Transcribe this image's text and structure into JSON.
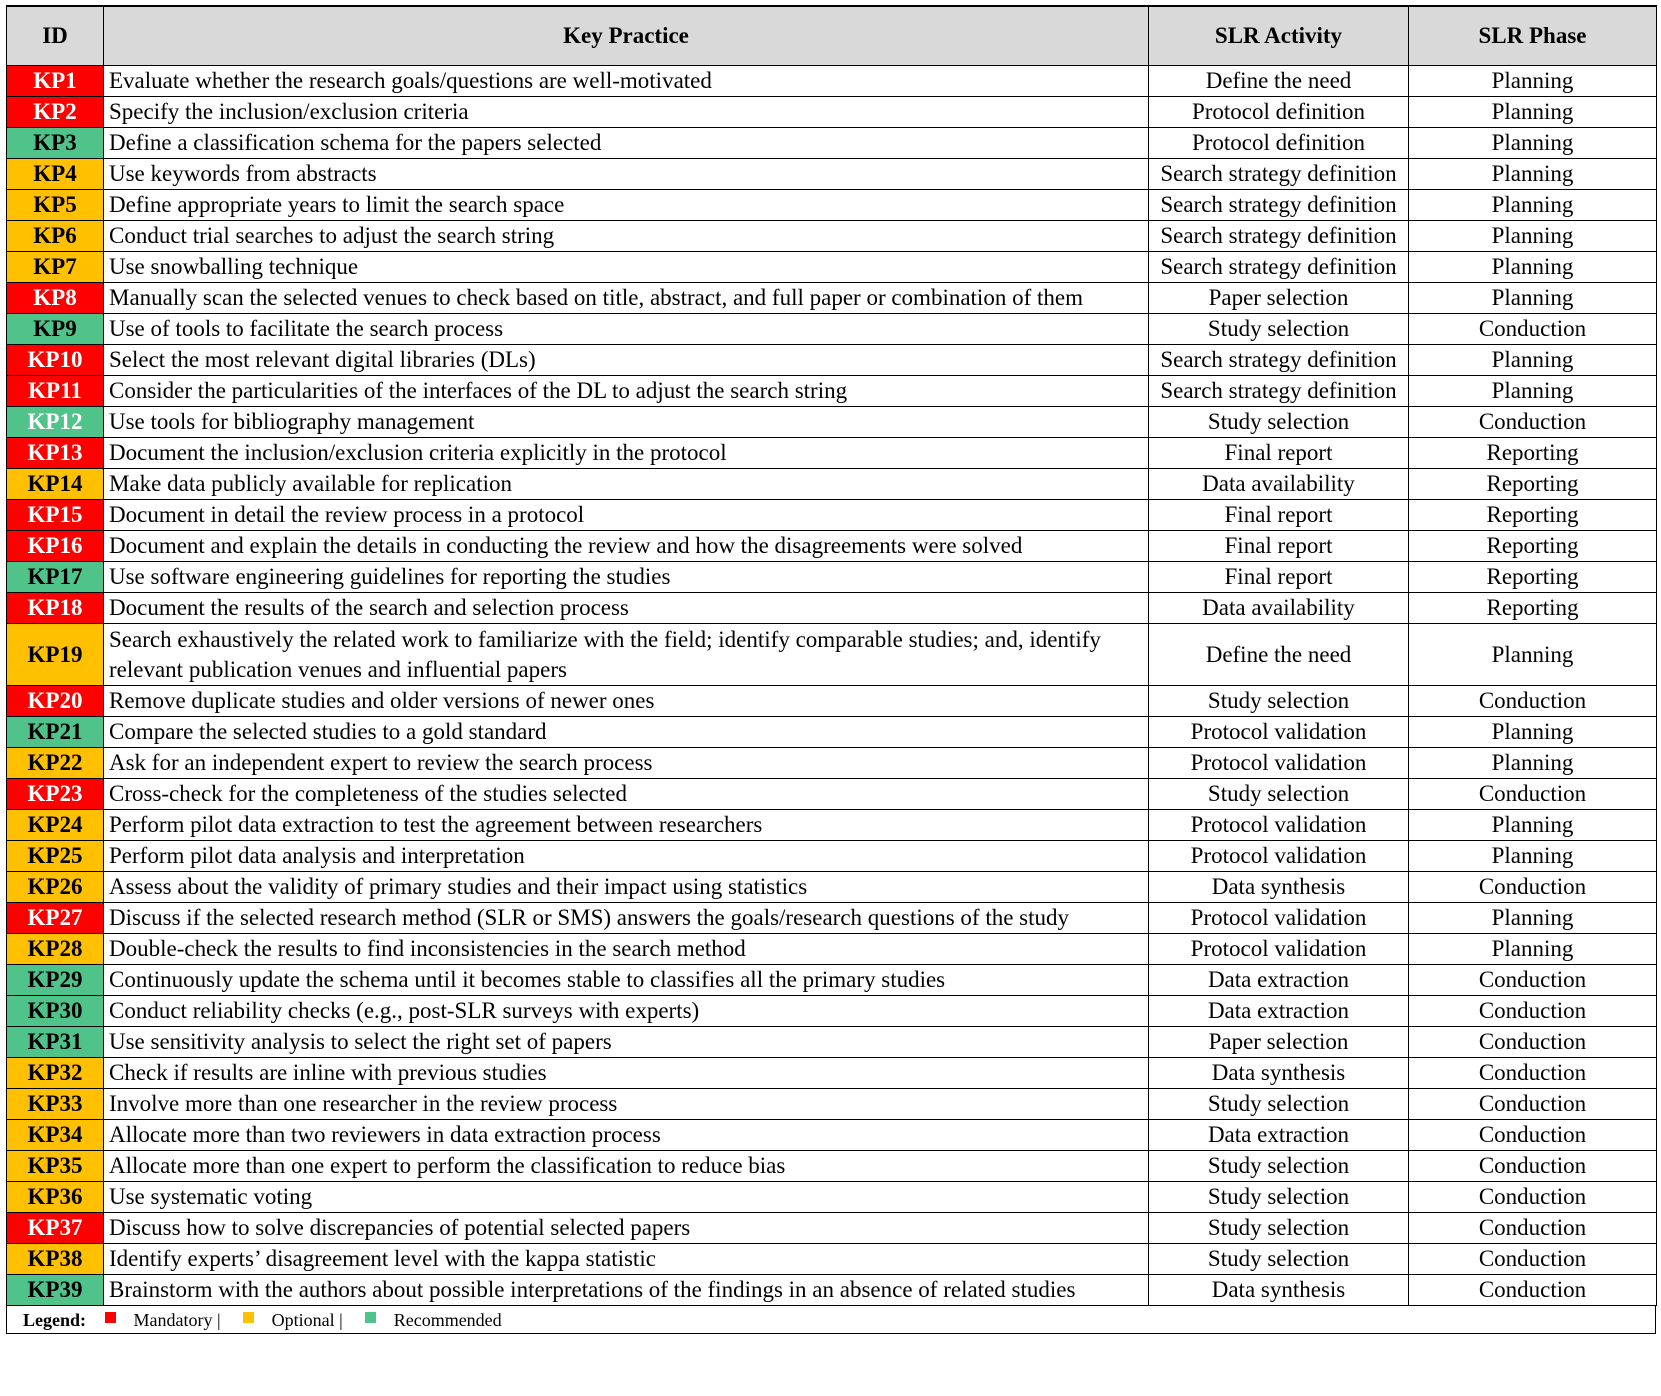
{
  "colors": {
    "mandatory": "#ff0000",
    "optional": "#ffc000",
    "recommended": "#4fc389",
    "header_bg": "#d9d9d9"
  },
  "columns": [
    "ID",
    "Key Practice",
    "SLR Activity",
    "SLR Phase"
  ],
  "rows": [
    {
      "id": "KP1",
      "practice": "Evaluate whether the research goals/questions are well-motivated",
      "activity": "Define the need",
      "phase": "Planning",
      "category": "mandatory"
    },
    {
      "id": "KP2",
      "practice": "Specify the inclusion/exclusion criteria",
      "activity": "Protocol definition",
      "phase": "Planning",
      "category": "mandatory"
    },
    {
      "id": "KP3",
      "practice": "Define a classification schema for the papers selected",
      "activity": "Protocol definition",
      "phase": "Planning",
      "category": "recommended"
    },
    {
      "id": "KP4",
      "practice": "Use keywords from abstracts",
      "activity": "Search strategy definition",
      "phase": "Planning",
      "category": "optional"
    },
    {
      "id": "KP5",
      "practice": "Define appropriate years to limit the search space",
      "activity": "Search strategy definition",
      "phase": "Planning",
      "category": "optional"
    },
    {
      "id": "KP6",
      "practice": "Conduct trial searches to adjust the search string",
      "activity": "Search strategy definition",
      "phase": "Planning",
      "category": "optional"
    },
    {
      "id": "KP7",
      "practice": "Use snowballing technique",
      "activity": "Search strategy definition",
      "phase": "Planning",
      "category": "optional"
    },
    {
      "id": "KP8",
      "practice": "Manually scan the selected venues to check based on title, abstract, and full paper or combination of them",
      "activity": "Paper selection",
      "phase": "Planning",
      "category": "mandatory"
    },
    {
      "id": "KP9",
      "practice": "Use of tools to facilitate the search process",
      "activity": "Study selection",
      "phase": "Conduction",
      "category": "recommended"
    },
    {
      "id": "KP10",
      "practice": "Select the most relevant digital libraries (DLs)",
      "activity": "Search strategy definition",
      "phase": "Planning",
      "category": "mandatory"
    },
    {
      "id": "KP11",
      "practice": "Consider the particularities of the interfaces of the DL to adjust the search string",
      "activity": "Search strategy definition",
      "phase": "Planning",
      "category": "mandatory"
    },
    {
      "id": "KP12",
      "practice": "Use tools for bibliography management",
      "activity": "Study selection",
      "phase": "Conduction",
      "category": "recommended"
    },
    {
      "id": "KP13",
      "practice": "Document the inclusion/exclusion criteria explicitly in the protocol",
      "activity": "Final report",
      "phase": "Reporting",
      "category": "mandatory"
    },
    {
      "id": "KP14",
      "practice": "Make data publicly available for replication",
      "activity": "Data availability",
      "phase": "Reporting",
      "category": "optional"
    },
    {
      "id": "KP15",
      "practice": "Document in detail the review process in a protocol",
      "activity": "Final report",
      "phase": "Reporting",
      "category": "mandatory"
    },
    {
      "id": "KP16",
      "practice": "Document and explain the details in conducting the review and how the disagreements were solved",
      "activity": "Final report",
      "phase": "Reporting",
      "category": "mandatory"
    },
    {
      "id": "KP17",
      "practice": "Use software engineering guidelines for reporting the studies",
      "activity": "Final report",
      "phase": "Reporting",
      "category": "recommended"
    },
    {
      "id": "KP18",
      "practice": "Document the results of the search and selection process",
      "activity": "Data availability",
      "phase": "Reporting",
      "category": "mandatory"
    },
    {
      "id": "KP19",
      "practice": "Search exhaustively the related work to familiarize with the field; identify comparable studies; and, identify relevant publication venues and influential papers",
      "activity": "Define the need",
      "phase": "Planning",
      "category": "optional"
    },
    {
      "id": "KP20",
      "practice": "Remove duplicate studies and older versions of newer ones",
      "activity": "Study selection",
      "phase": "Conduction",
      "category": "mandatory"
    },
    {
      "id": "KP21",
      "practice": "Compare the selected studies to a gold standard",
      "activity": "Protocol validation",
      "phase": "Planning",
      "category": "recommended"
    },
    {
      "id": "KP22",
      "practice": "Ask for an independent expert to review the search process",
      "activity": "Protocol validation",
      "phase": "Planning",
      "category": "optional"
    },
    {
      "id": "KP23",
      "practice": "Cross-check for the completeness of the studies selected",
      "activity": "Study selection",
      "phase": "Conduction",
      "category": "mandatory"
    },
    {
      "id": "KP24",
      "practice": "Perform pilot data extraction to test the agreement between researchers",
      "activity": "Protocol validation",
      "phase": "Planning",
      "category": "optional"
    },
    {
      "id": "KP25",
      "practice": "Perform pilot data analysis and interpretation",
      "activity": "Protocol validation",
      "phase": "Planning",
      "category": "optional"
    },
    {
      "id": "KP26",
      "practice": "Assess about the validity of primary studies and their impact using statistics",
      "activity": "Data synthesis",
      "phase": "Conduction",
      "category": "optional"
    },
    {
      "id": "KP27",
      "practice": "Discuss if the selected research method (SLR or SMS) answers the goals/research questions of the study",
      "activity": "Protocol validation",
      "phase": "Planning",
      "category": "mandatory"
    },
    {
      "id": "KP28",
      "practice": "Double-check the results to find inconsistencies in the search method",
      "activity": "Protocol validation",
      "phase": "Planning",
      "category": "optional"
    },
    {
      "id": "KP29",
      "practice": "Continuously update the schema until it becomes stable to classifies all the primary studies",
      "activity": "Data extraction",
      "phase": "Conduction",
      "category": "recommended"
    },
    {
      "id": "KP30",
      "practice": "Conduct reliability checks (e.g., post-SLR surveys with experts)",
      "activity": "Data extraction",
      "phase": "Conduction",
      "category": "recommended"
    },
    {
      "id": "KP31",
      "practice": "Use sensitivity analysis to select the right set of papers",
      "activity": "Paper selection",
      "phase": "Conduction",
      "category": "recommended"
    },
    {
      "id": "KP32",
      "practice": "Check if results are inline with previous studies",
      "activity": "Data synthesis",
      "phase": "Conduction",
      "category": "optional"
    },
    {
      "id": "KP33",
      "practice": "Involve more than one researcher in the review process",
      "activity": "Study selection",
      "phase": "Conduction",
      "category": "optional"
    },
    {
      "id": "KP34",
      "practice": "Allocate more than two reviewers in data extraction process",
      "activity": "Data extraction",
      "phase": "Conduction",
      "category": "optional"
    },
    {
      "id": "KP35",
      "practice": "Allocate more than one expert to perform the classification to reduce bias",
      "activity": "Study selection",
      "phase": "Conduction",
      "category": "optional"
    },
    {
      "id": "KP36",
      "practice": "Use systematic voting",
      "activity": "Study selection",
      "phase": "Conduction",
      "category": "optional"
    },
    {
      "id": "KP37",
      "practice": "Discuss how to solve discrepancies of potential selected papers",
      "activity": "Study selection",
      "phase": "Conduction",
      "category": "mandatory"
    },
    {
      "id": "KP38",
      "practice": "Identify experts’ disagreement level with the kappa statistic",
      "activity": "Study selection",
      "phase": "Conduction",
      "category": "optional"
    },
    {
      "id": "KP39",
      "practice": "Brainstorm with the authors about possible interpretations of the findings in an absence of related studies",
      "activity": "Data synthesis",
      "phase": "Conduction",
      "category": "recommended"
    }
  ],
  "legend": {
    "label": "Legend:",
    "items": [
      {
        "text": "Mandatory |",
        "category": "mandatory"
      },
      {
        "text": "Optional |",
        "category": "optional"
      },
      {
        "text": "Recommended",
        "category": "recommended"
      }
    ]
  }
}
